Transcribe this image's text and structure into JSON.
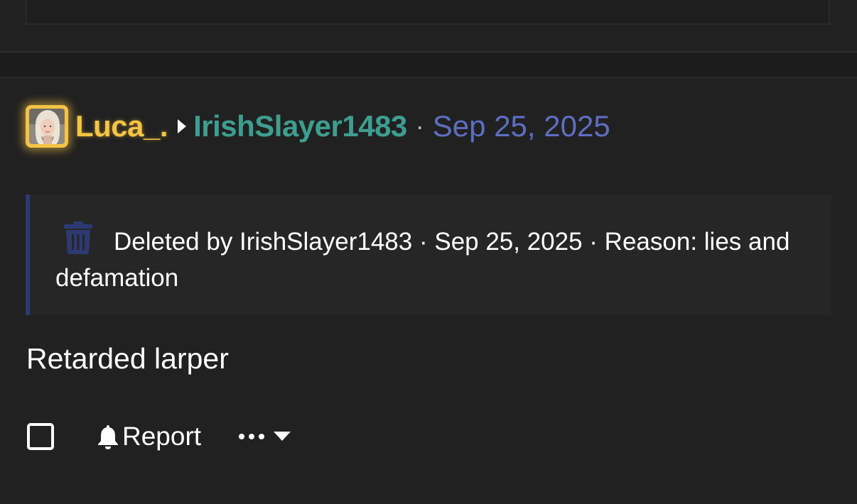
{
  "post": {
    "author": "Luca_.",
    "recipient": "IrishSlayer1483",
    "separator": "·",
    "date": "Sep 25, 2025",
    "deleted_notice": "Deleted by IrishSlayer1483 · Sep 25, 2025 · Reason: lies and defamation",
    "body": "Retarded larper",
    "icons": {
      "avatar": "avatar-image",
      "arrow": "arrow-right-icon",
      "deleted": "trash-icon"
    }
  },
  "actions": {
    "report_label": "Report",
    "icons": {
      "select": "checkbox-icon",
      "report": "bell-icon",
      "more": "ellipsis-icon",
      "more_caret": "caret-down-icon"
    }
  },
  "colors": {
    "background": "#212121",
    "author": "#f5c445",
    "recipient": "#3e9e8f",
    "date": "#5e6ec2",
    "notice_background": "#262626",
    "notice_border": "#2d3a72",
    "trash": "#2d3a72"
  }
}
